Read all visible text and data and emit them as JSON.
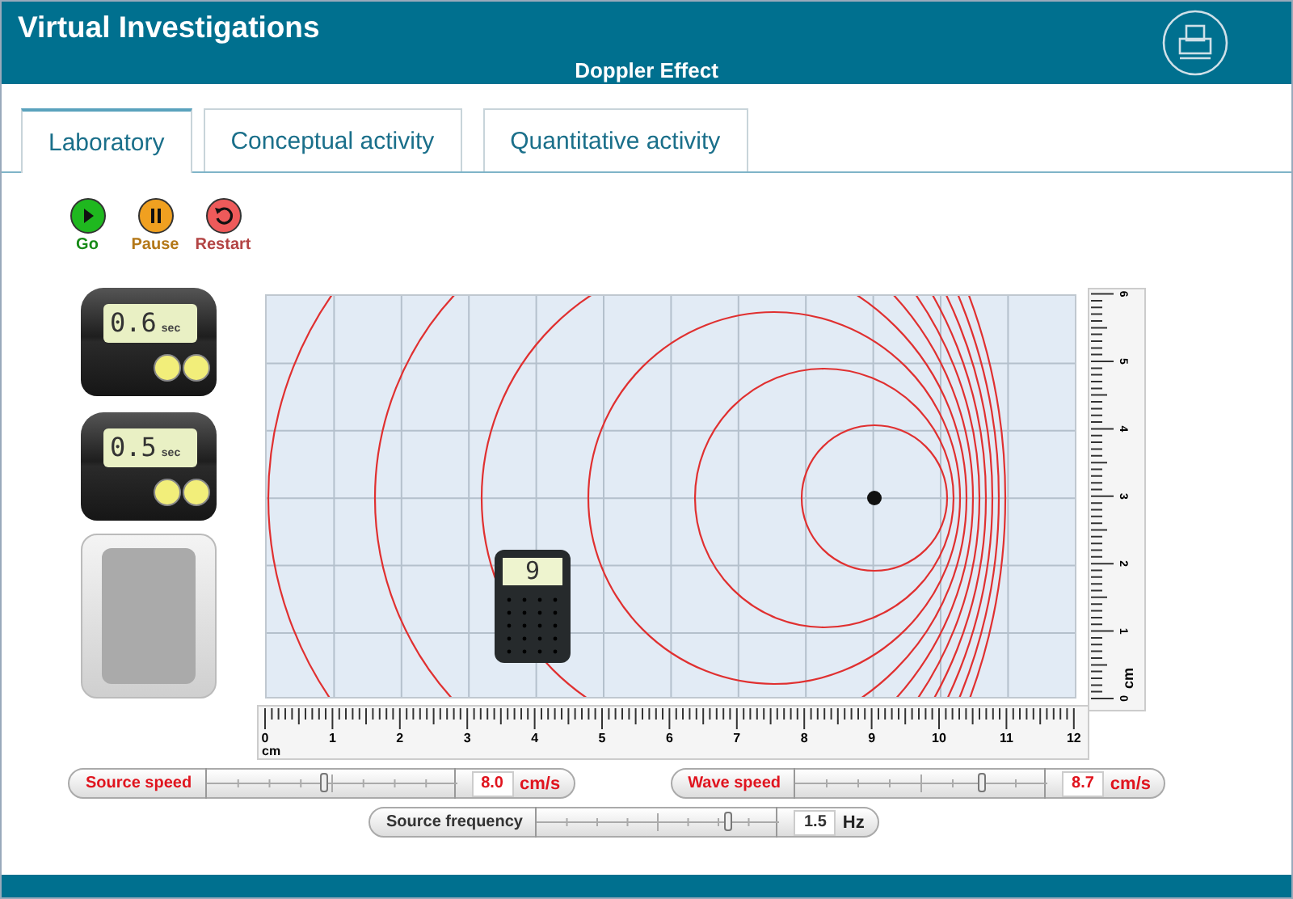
{
  "header": {
    "app_title": "Virtual Investigations",
    "page_title": "Doppler Effect"
  },
  "tabs": [
    {
      "label": "Laboratory",
      "selected": true
    },
    {
      "label": "Conceptual activity",
      "selected": false
    },
    {
      "label": "Quantitative activity",
      "selected": false
    }
  ],
  "controls": [
    {
      "kind": "play",
      "label": "Go",
      "color": "#1fb81f"
    },
    {
      "kind": "pause",
      "label": "Pause",
      "color": "#f0a020"
    },
    {
      "kind": "restart",
      "label": "Restart",
      "color": "#ee5a5a"
    }
  ],
  "stopwatches": [
    {
      "reading": "0.6",
      "unit": "sec"
    },
    {
      "reading": "0.5",
      "unit": "sec"
    }
  ],
  "detector": {
    "reading": "9"
  },
  "ruler_x": {
    "labels": [
      "0",
      "1",
      "2",
      "3",
      "4",
      "5",
      "6",
      "7",
      "8",
      "9",
      "10",
      "11",
      "12"
    ],
    "unit": "cm"
  },
  "ruler_y": {
    "labels": [
      "0",
      "1",
      "2",
      "3",
      "4",
      "5",
      "6"
    ],
    "unit": "cm"
  },
  "sliders": [
    {
      "label": "Source speed",
      "level": 0.48,
      "value": "8.0",
      "unit": "cm/s",
      "color": "#e0141e"
    },
    {
      "label": "Wave speed",
      "level": 0.75,
      "value": "8.7",
      "unit": "cm/s",
      "color": "#e0141e"
    },
    {
      "label": "Source frequency",
      "level": 0.8,
      "value": "1.5",
      "unit": "Hz",
      "color": "#333333"
    }
  ]
}
